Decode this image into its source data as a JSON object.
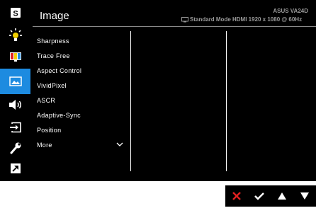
{
  "sidebar": {
    "items": [
      {
        "icon": "splendid-s-icon",
        "active": false
      },
      {
        "icon": "blue-light-filter-icon",
        "active": false
      },
      {
        "icon": "color-icon",
        "active": false
      },
      {
        "icon": "image-icon",
        "active": true
      },
      {
        "icon": "sound-icon",
        "active": false
      },
      {
        "icon": "input-select-icon",
        "active": false
      },
      {
        "icon": "system-setup-icon",
        "active": false
      },
      {
        "icon": "shortcut-icon",
        "active": false
      }
    ]
  },
  "header": {
    "title": "Image",
    "mode": "Standard Mode",
    "model": "ASUS VA24D",
    "signal": "HDMI 1920 x 1080 @ 60Hz"
  },
  "menu": {
    "items": [
      "Sharpness",
      "Trace Free",
      "Aspect Control",
      "VividPixel",
      "ASCR",
      "Adaptive-Sync",
      "Position",
      "More"
    ]
  },
  "controls": [
    "close-x-icon",
    "check-icon",
    "up-arrow-icon",
    "down-arrow-icon"
  ],
  "colors": {
    "accent": "#1d8be0",
    "close_red": "#e02020"
  }
}
